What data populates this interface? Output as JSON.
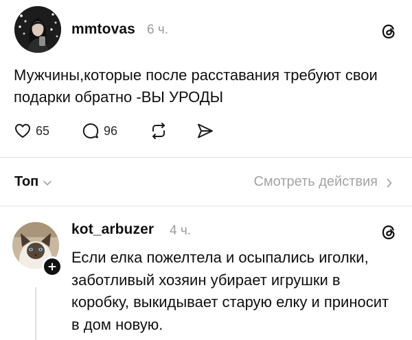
{
  "post": {
    "username": "mmtovas",
    "time": "6 ч.",
    "text": "Мужчины,которые после расставания требуют свои подарки обратно -ВЫ УРОДЫ",
    "likes": "65",
    "replies": "96",
    "icons": {
      "logo": "threads-icon",
      "like": "heart-icon",
      "reply": "comment-icon",
      "repost": "repost-icon",
      "share": "send-icon"
    }
  },
  "sort": {
    "label": "Топ",
    "chevron": "chevron-down-icon"
  },
  "see_actions": {
    "label": "Смотреть действия",
    "chevron": "chevron-right-icon"
  },
  "reply": {
    "username": "kot_arbuzer",
    "time": "4 ч.",
    "text": "Если елка пожелтела и осыпались иголки, заботливый хозяин убирает игрушки в коробку, выкидывает старую елку и приносит в дом новую.",
    "icons": {
      "logo": "threads-icon",
      "follow": "plus-icon"
    }
  },
  "colors": {
    "text": "#0f0f0f",
    "muted": "#9a9a9a",
    "divider": "#e3e3e3"
  }
}
